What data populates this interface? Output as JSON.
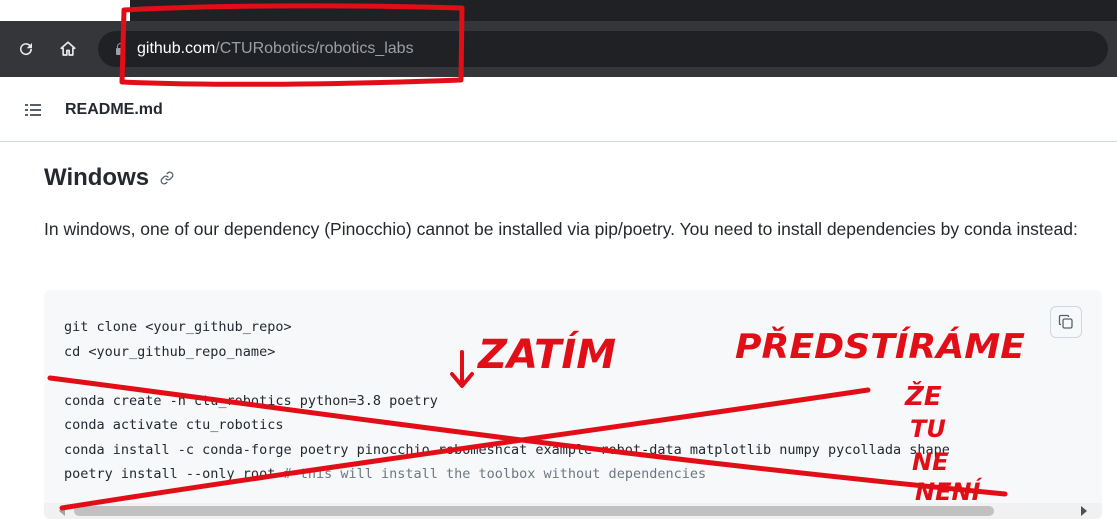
{
  "browser": {
    "url_host": "github.com",
    "url_path": "/CTURobotics/robotics_labs"
  },
  "file_header": {
    "title": "README.md"
  },
  "readme": {
    "heading": "Windows",
    "paragraph": "In windows, one of our dependency (Pinocchio) cannot be installed via pip/poetry. You need to install dependencies by conda instead:",
    "code_lines": [
      "git clone <your_github_repo>",
      "cd <your_github_repo_name>",
      "",
      "conda create -n ctu_robotics python=3.8 poetry",
      "conda activate ctu_robotics",
      "conda install -c conda-forge poetry pinocchio robomeshcat example-robot-data matplotlib numpy pycollada shape",
      "poetry install --only root # this will install the toolbox without dependencies"
    ]
  },
  "annotation": {
    "color": "#e20e17",
    "text_zatim": "ZATÍM",
    "text_predstirame": "PŘEDSTÍRÁME",
    "text_ze": "ŽE",
    "text_tu": "TU",
    "text_ne": "NE",
    "text_neni": "NENÍ"
  }
}
